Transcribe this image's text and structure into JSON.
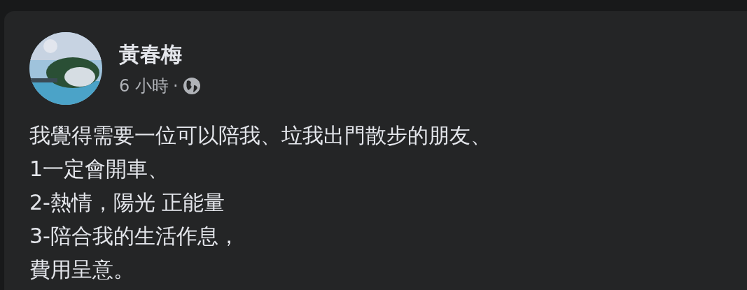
{
  "post": {
    "author": "黃春梅",
    "time": "6 小時",
    "separator": "·",
    "lines": [
      "我覺得需要一位可以陪我、垃我出門散步的朋友、",
      "1一定會開車、",
      "2-熱情，陽光 正能量",
      "3-陪合我的生活作息，",
      "費用呈意。"
    ]
  }
}
